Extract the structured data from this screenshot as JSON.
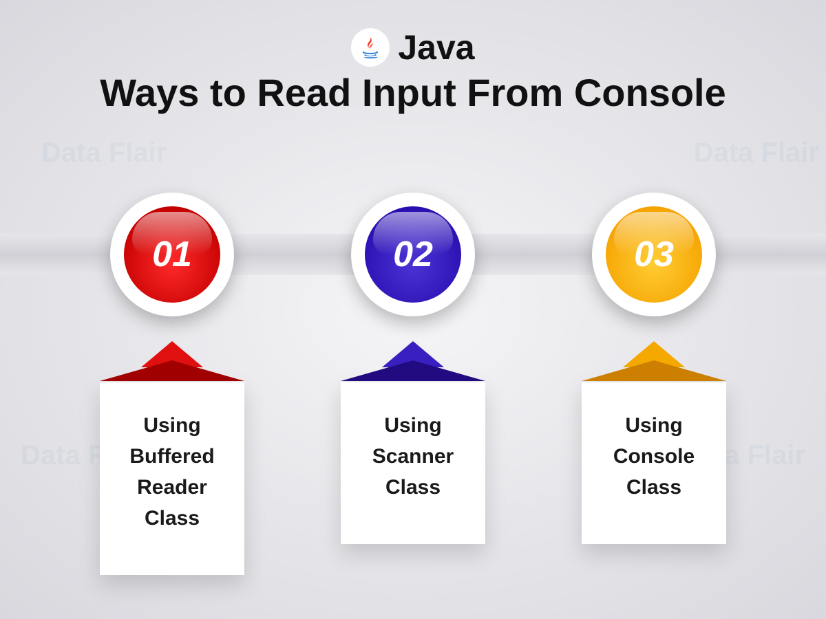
{
  "header": {
    "title": "Java",
    "subtitle": "Ways to Read Input From Console"
  },
  "steps": [
    {
      "number": "01",
      "label": "Using Buffered Reader Class",
      "color": "red"
    },
    {
      "number": "02",
      "label": "Using Scanner Class",
      "color": "blue"
    },
    {
      "number": "03",
      "label": "Using Console Class",
      "color": "yellow"
    }
  ],
  "watermark": "Data Flair"
}
